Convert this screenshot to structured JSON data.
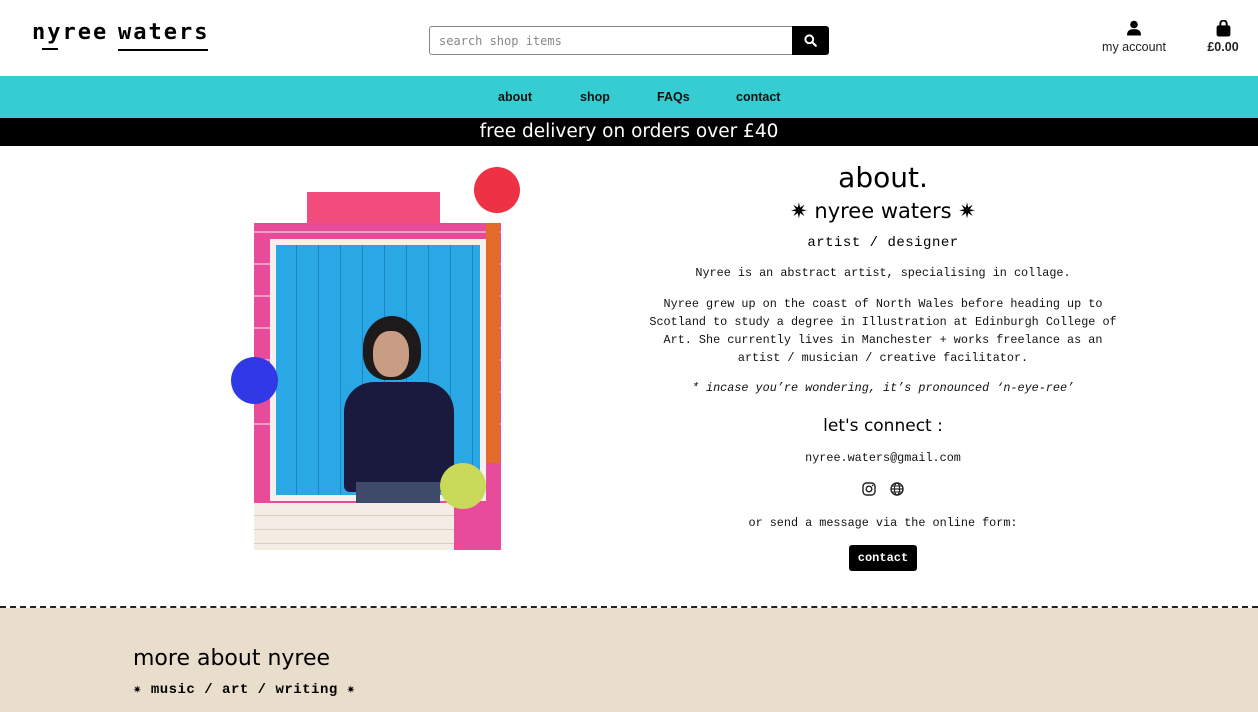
{
  "header": {
    "logo_first": "nyree",
    "logo_second": "waters",
    "search_placeholder": "search shop items",
    "account_label": "my account",
    "bag_total": "£0.00"
  },
  "nav": {
    "items": [
      {
        "label": "about"
      },
      {
        "label": "shop"
      },
      {
        "label": "FAQs"
      },
      {
        "label": "contact"
      }
    ]
  },
  "banner": {
    "text": "free delivery on orders over £40"
  },
  "about": {
    "title": "about.",
    "name": "✷ nyree waters ✷",
    "role": "artist / designer",
    "intro": "Nyree is an abstract artist, specialising in collage.",
    "bio": "Nyree grew up on the coast of North Wales before heading up to Scotland to study a degree in Illustration at Edinburgh College of Art. She currently lives in Manchester + works freelance as an artist / musician / creative facilitator.",
    "pronunciation": "* incase you’re wondering, it’s pronounced ‘n-eye-ree’",
    "connect_heading": "let's connect :",
    "email": "nyree.waters@gmail.com",
    "socials": [
      "instagram-icon",
      "globe-icon"
    ],
    "send_message": "or send a message via the online form:",
    "contact_button": "contact"
  },
  "more": {
    "heading": "more about nyree",
    "subheading": "✷ music / art / writing ✷"
  },
  "colors": {
    "nav_bg": "#36cdd2",
    "banner_bg": "#000000",
    "more_bg": "#e9ddcc",
    "dot_red": "#ee3144",
    "dot_blue": "#3138e6",
    "dot_green": "#c9d95a",
    "tape_pink": "#f24b7d"
  }
}
